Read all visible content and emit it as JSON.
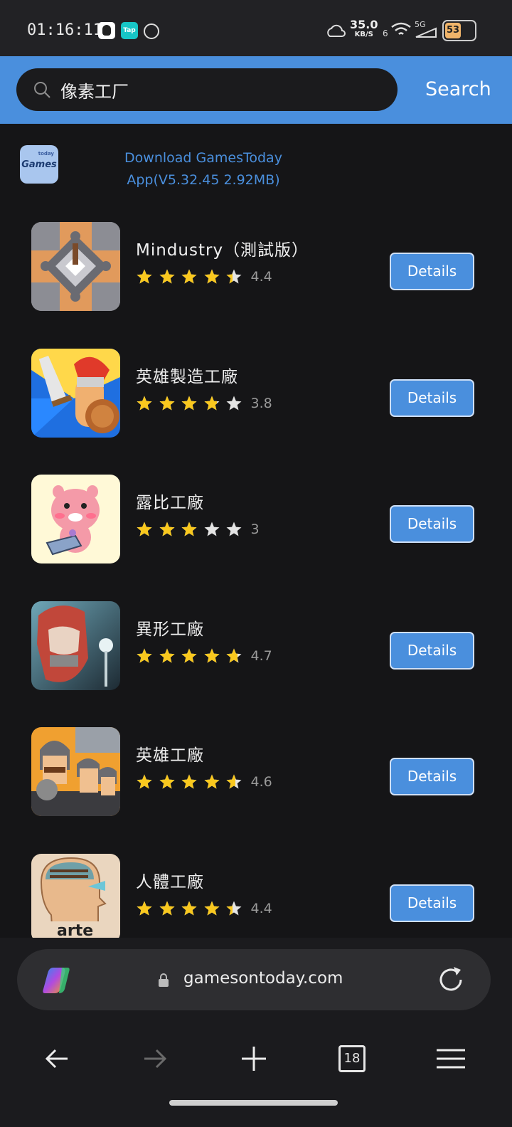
{
  "status_bar": {
    "time": "01:16:11",
    "network_speed": "35.0",
    "network_speed_unit": "KB/S",
    "signal_label": "5G",
    "sim_number": "6",
    "battery_level": "53"
  },
  "search": {
    "query": "像素工厂",
    "button_label": "Search"
  },
  "banner": {
    "line1": "Download GamesToday",
    "line2": "App(V5.32.45  2.92MB)",
    "logo_text": "Games",
    "logo_small": "today"
  },
  "results": [
    {
      "name": "Mindustry（測試版）",
      "rating": 4.4,
      "rating_text": "4.4",
      "button": "Details"
    },
    {
      "name": "英雄製造工廠",
      "rating": 3.8,
      "rating_text": "3.8",
      "button": "Details"
    },
    {
      "name": "露比工廠",
      "rating": 3.0,
      "rating_text": "3",
      "button": "Details"
    },
    {
      "name": "異形工廠",
      "rating": 4.7,
      "rating_text": "4.7",
      "button": "Details"
    },
    {
      "name": "英雄工廠",
      "rating": 4.6,
      "rating_text": "4.6",
      "button": "Details"
    },
    {
      "name": "人體工廠",
      "rating": 4.4,
      "rating_text": "4.4",
      "button": "Details",
      "icon_text": "arte"
    }
  ],
  "browser": {
    "url": "gamesontoday.com",
    "tab_count": "18"
  },
  "colors": {
    "accent": "#4a8fdd",
    "star_filled": "#f9c81e",
    "star_empty": "#e4e4e4",
    "background": "#151517"
  }
}
